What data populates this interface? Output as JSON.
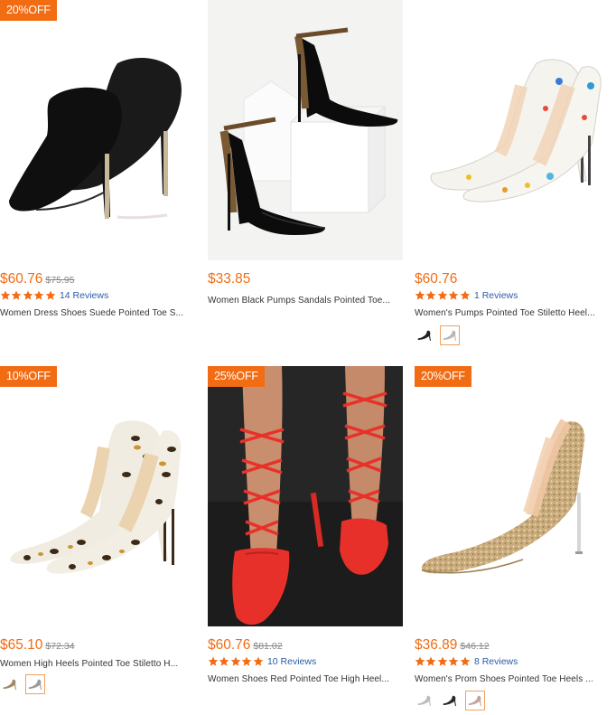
{
  "products": [
    {
      "badge": "20%OFF",
      "price": "$60.76",
      "old_price": "$75.95",
      "rating_stars": 5,
      "reviews": "14 Reviews",
      "title": "Women Dress Shoes Suede Pointed Toe S...",
      "image": "black-suede-stiletto-pumps",
      "swatches": []
    },
    {
      "badge": "",
      "price": "$33.85",
      "old_price": "",
      "rating_stars": 0,
      "reviews": "",
      "title": "Women Black Pumps Sandals Pointed Toe...",
      "image": "black-patent-ankle-strap-pumps",
      "swatches": []
    },
    {
      "badge": "",
      "price": "$60.76",
      "old_price": "",
      "rating_stars": 5,
      "reviews": "1 Reviews",
      "title": "Women's Pumps Pointed Toe Stiletto Heel...",
      "image": "white-graffiti-print-pumps",
      "swatches": [
        "black-shoe-swatch",
        "silver-shoe-swatch"
      ]
    },
    {
      "badge": "10%OFF",
      "price": "$65.10",
      "old_price": "$72.34",
      "rating_stars": 0,
      "reviews": "",
      "title": "Women High Heels Pointed Toe Stiletto H...",
      "image": "leopard-print-pumps",
      "swatches": [
        "tan-shoe-swatch",
        "gray-shoe-swatch"
      ]
    },
    {
      "badge": "25%OFF",
      "price": "$60.76",
      "old_price": "$81.02",
      "rating_stars": 5,
      "reviews": "10 Reviews",
      "title": "Women Shoes Red Pointed Toe High Heel...",
      "image": "red-lace-up-pumps",
      "swatches": []
    },
    {
      "badge": "20%OFF",
      "price": "$36.89",
      "old_price": "$46.12",
      "rating_stars": 5,
      "reviews": "8 Reviews",
      "title": "Women's Prom Shoes Pointed Toe Heels ...",
      "image": "gold-glitter-pumps",
      "swatches": [
        "silver-shoe-swatch",
        "black-shoe-swatch",
        "rose-shoe-swatch"
      ]
    }
  ],
  "colors": {
    "accent": "#f26c13",
    "review_link": "#2a5ca8",
    "old_price": "#888888"
  }
}
